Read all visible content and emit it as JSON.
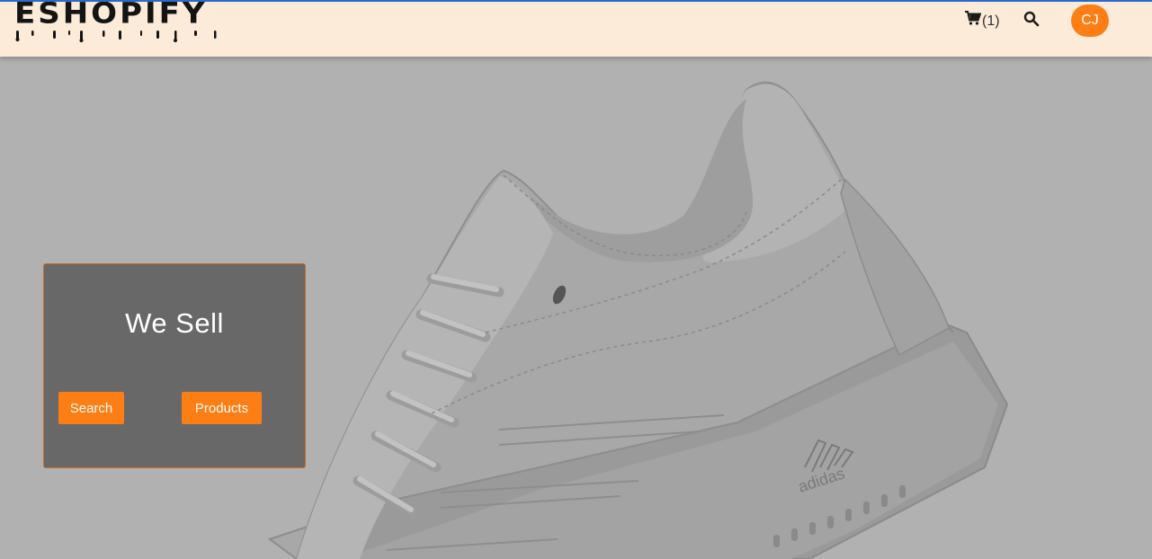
{
  "brand": {
    "logo_text": "ESHOPIFY"
  },
  "header": {
    "cart_count": "(1)",
    "avatar_initials": "CJ"
  },
  "hero": {
    "title": "We Sell",
    "search_button": "Search",
    "products_button": "Products",
    "image": "sneaker-image"
  },
  "icons": {
    "cart": "cart-icon",
    "search": "search-icon"
  },
  "colors": {
    "accent": "#fd7e14",
    "navbar_bg": "#fbebd8",
    "card_bg": "#686868",
    "hero_overlay": "#b1b1b1"
  }
}
